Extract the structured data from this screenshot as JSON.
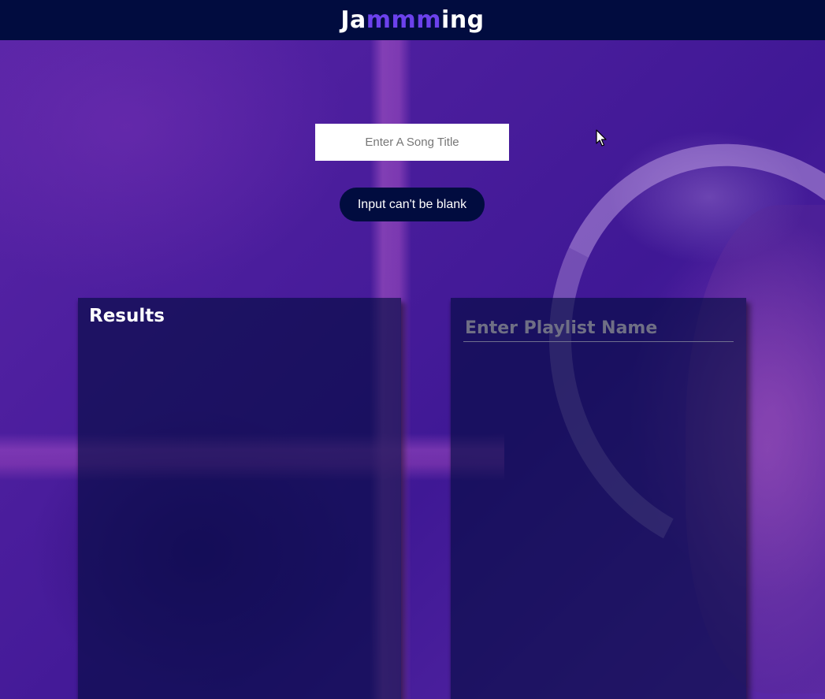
{
  "header": {
    "brand_prefix": "Ja",
    "brand_accent": "mmm",
    "brand_suffix": "ing"
  },
  "search": {
    "placeholder": "Enter A Song Title",
    "value": "",
    "button_label": "Input can't be blank"
  },
  "results": {
    "title": "Results"
  },
  "playlist": {
    "name_placeholder": "Enter Playlist Name",
    "name_value": ""
  },
  "colors": {
    "navbar": "#010c3f",
    "brand_accent": "#6c41ec",
    "background": "#4a1f9a",
    "panel": "#010c3f"
  },
  "icons": {
    "pointer": "mouse-pointer-icon"
  }
}
